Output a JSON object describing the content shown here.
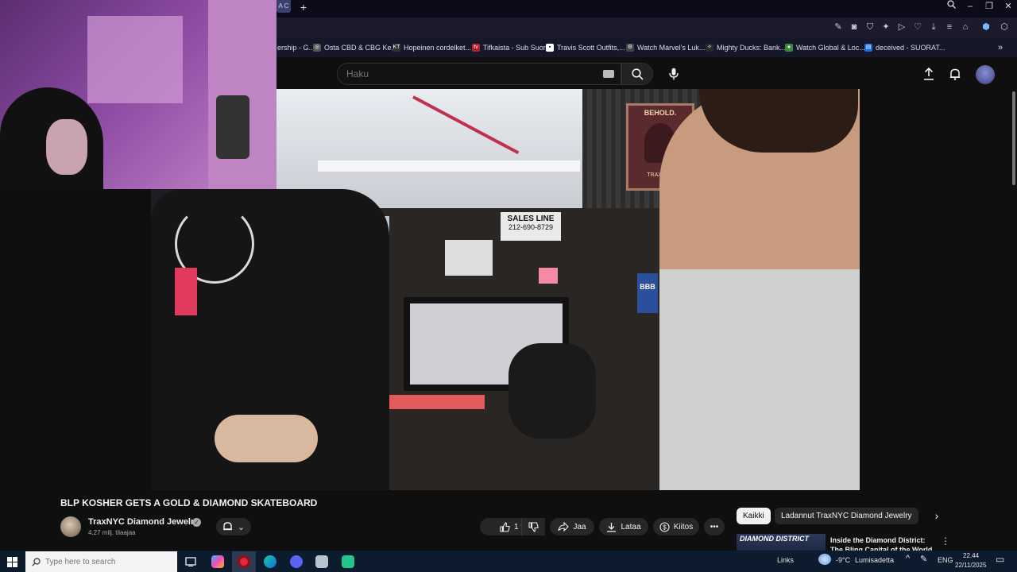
{
  "browser": {
    "tab_stub_label": "A C",
    "new_tab_icon": "plus-icon",
    "window_controls": [
      "search-icon",
      "minimize-icon",
      "restore-icon",
      "close-icon"
    ],
    "bookmarks": [
      {
        "label": "ership - G...",
        "icon": "page-icon"
      },
      {
        "label": "Osta CBD & CBG Ke...",
        "icon": "globe-icon"
      },
      {
        "label": "Hopeinen cordelket...",
        "icon": "kt-icon",
        "icon_text": "KT"
      },
      {
        "label": "Tifkaista - Sub Suora",
        "icon": "tv-icon",
        "icon_text": "tv"
      },
      {
        "label": "Travis Scott Outfits,...",
        "icon": "bookmark-icon"
      },
      {
        "label": "Watch Marvel's Luk...",
        "icon": "gear-icon"
      },
      {
        "label": "Mighty Ducks: Bank...",
        "icon": "duck-icon"
      },
      {
        "label": "Watch Global & Loc...",
        "icon": "camera-icon"
      },
      {
        "label": "deceived - SUORAT...",
        "icon": "page-icon"
      }
    ],
    "more_bookmarks_icon": "chevron-right-icon"
  },
  "youtube": {
    "search_placeholder": "Haku",
    "video_title": "BLP KOSHER GETS A GOLD & DIAMOND SKATEBOARD",
    "channel_name": "TraxNYC Diamond Jewelry",
    "subscribers": "4,27 milj. tilaajaa",
    "like_count": "1 t.",
    "share_label": "Jaa",
    "download_label": "Lataa",
    "thanks_label": "Kiitos",
    "chips": [
      "Kaikki",
      "Ladannut TraxNYC Diamond Jewelry"
    ],
    "recommended": {
      "thumb_text": "DIAMOND DISTRICT",
      "title": "Inside the Diamond District: The Bling Capital of the World"
    }
  },
  "video_scene": {
    "sales_line": "SALES LINE",
    "sales_phone": "212-690-8729",
    "poster_top": "BEHOLD.",
    "poster_bottom": "TRAXNYC",
    "badge": "BBB"
  },
  "taskbar": {
    "search_placeholder": "Type here to search",
    "links_label": "Links",
    "weather": "-9°C",
    "weather_desc": "Lumisadetta",
    "language": "ENG",
    "time": "22.44",
    "date": "22/11/2025"
  },
  "colors": {
    "page_bg": "#0f0f0f",
    "browser_chrome": "#1b1b2b",
    "taskbar": "#0c1b2e",
    "chip_active": "#f1f1f1"
  }
}
